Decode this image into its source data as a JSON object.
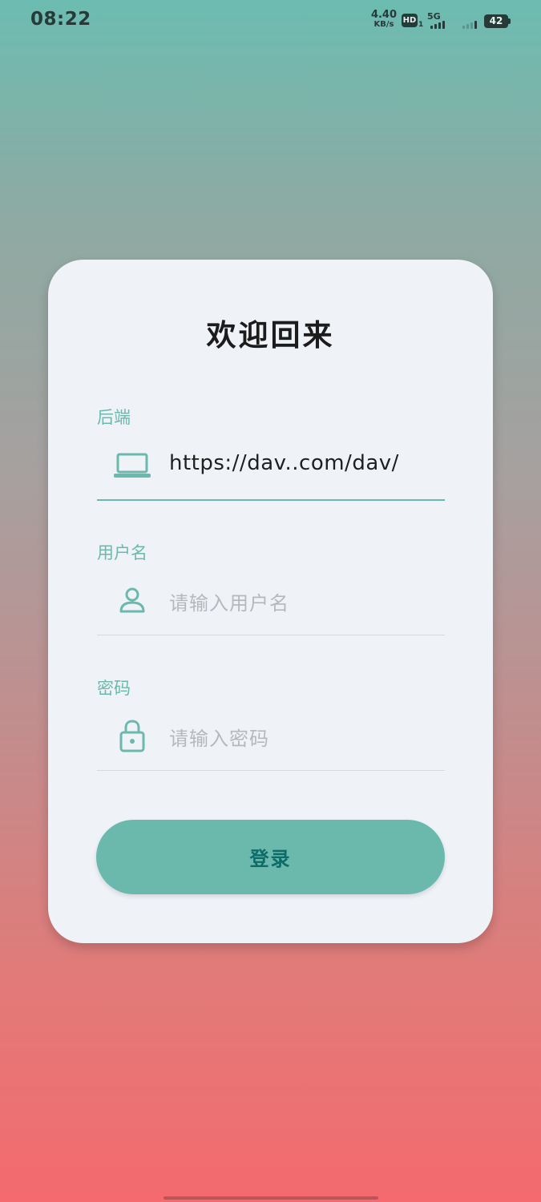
{
  "status_bar": {
    "time": "08:22",
    "net_speed_value": "4.40",
    "net_speed_unit": "KB/s",
    "hd_label": "HD",
    "hd_sub": "1",
    "network_type": "5G",
    "battery_level": "42"
  },
  "login": {
    "title": "欢迎回来",
    "backend": {
      "label": "后端",
      "value": "https://dav..com/dav/",
      "icon": "laptop-icon"
    },
    "username": {
      "label": "用户名",
      "value": "",
      "placeholder": "请输入用户名",
      "icon": "person-icon"
    },
    "password": {
      "label": "密码",
      "value": "",
      "placeholder": "请输入密码",
      "icon": "lock-icon"
    },
    "submit_label": "登录"
  },
  "colors": {
    "accent": "#6bb9ad",
    "button_text": "#0e6b66",
    "card_background": "#eff3f8",
    "gradient_top": "#6cbcb1",
    "gradient_bottom": "#f46a6e"
  }
}
